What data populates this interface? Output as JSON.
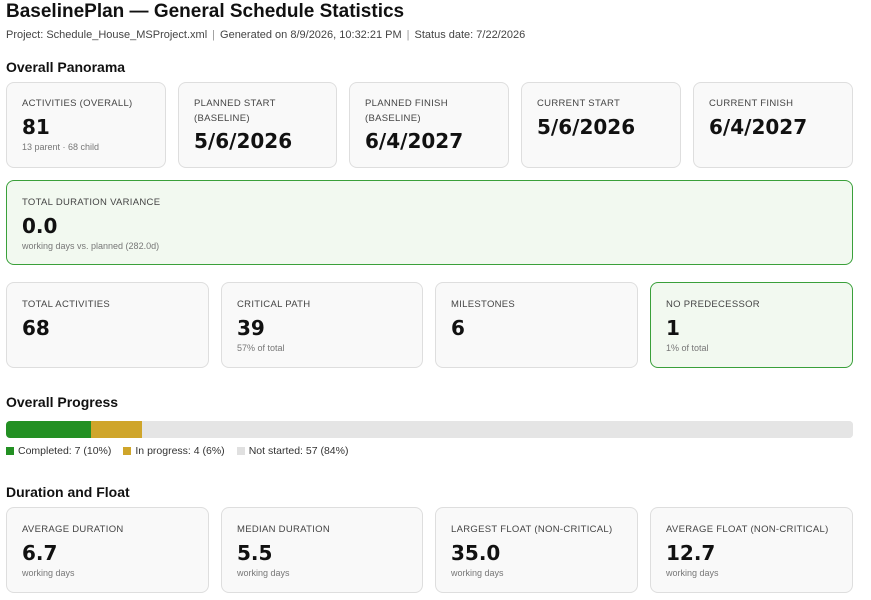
{
  "header": {
    "title": "BaselinePlan — General Schedule Statistics",
    "project": "Project: Schedule_House_MSProject.xml",
    "generated": "Generated on 8/9/2026, 10:32:21 PM",
    "status_date": "Status date: 7/22/2026"
  },
  "sections": {
    "overall_panorama": "Overall Panorama",
    "overall_progress": "Overall Progress",
    "duration_float": "Duration and Float"
  },
  "panorama": {
    "activities": {
      "label": "ACTIVITIES (OVERALL)",
      "value": "81",
      "sub": "13 parent · 68 child"
    },
    "planned_start": {
      "label": "PLANNED START (BASELINE)",
      "value": "5/6/2026"
    },
    "planned_finish": {
      "label": "PLANNED FINISH (BASELINE)",
      "value": "6/4/2027"
    },
    "current_start": {
      "label": "CURRENT START",
      "value": "5/6/2026"
    },
    "current_finish": {
      "label": "CURRENT FINISH",
      "value": "6/4/2027"
    },
    "variance": {
      "label": "TOTAL DURATION VARIANCE",
      "value": "0.0",
      "sub": "working days vs. planned (282.0d)"
    }
  },
  "counts": {
    "total": {
      "label": "TOTAL ACTIVITIES",
      "value": "68"
    },
    "critical": {
      "label": "CRITICAL PATH",
      "value": "39",
      "sub": "57% of total"
    },
    "milestones": {
      "label": "MILESTONES",
      "value": "6"
    },
    "no_predecessor": {
      "label": "NO PREDECESSOR",
      "value": "1",
      "sub": "1% of total"
    }
  },
  "progress": {
    "segments": [
      {
        "name": "completed",
        "fraction": 0.1,
        "color": "#239023"
      },
      {
        "name": "in_progress",
        "fraction": 0.06,
        "color": "#cfa52a"
      },
      {
        "name": "not_started",
        "fraction": 0.84,
        "color": "#e5e5e5"
      }
    ],
    "legend": {
      "completed": "Completed: 7 (10%)",
      "in_progress": "In progress: 4 (6%)",
      "not_started": "Not started: 57 (84%)"
    }
  },
  "duration": {
    "avg": {
      "label": "AVERAGE DURATION",
      "value": "6.7",
      "sub": "working days"
    },
    "median": {
      "label": "MEDIAN DURATION",
      "value": "5.5",
      "sub": "working days"
    },
    "largest_float": {
      "label": "LARGEST FLOAT (NON-CRITICAL)",
      "value": "35.0",
      "sub": "working days"
    },
    "avg_float": {
      "label": "AVERAGE FLOAT (NON-CRITICAL)",
      "value": "12.7",
      "sub": "working days"
    }
  }
}
